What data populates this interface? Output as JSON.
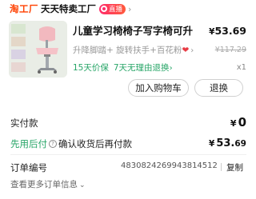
{
  "store": {
    "logo_text": "淘工厂",
    "name": "天天特卖工厂",
    "live_label": "直播"
  },
  "product": {
    "title": "儿童学习椅椅子写字椅可升",
    "price_currency": "¥",
    "price_value": "53.69",
    "spec_text": "升降脚踏+ 旋转扶手+百花粉",
    "original_price": "¥117.29",
    "promise_1": "15天价保",
    "promise_2": "7天无理由退换",
    "quantity": "x1"
  },
  "buttons": {
    "add_to_cart": "加入购物车",
    "return": "退换"
  },
  "payment": {
    "paid_label": "实付款",
    "paid_currency": "¥",
    "paid_value": "0",
    "credit_brand": "先用后付",
    "credit_rest": "确认收货后再付款",
    "credit_currency": "¥",
    "credit_int": "53.",
    "credit_cents": "69"
  },
  "order": {
    "number_label": "订单编号",
    "number_value": "4830824269943814512",
    "copy_label": "复制",
    "more_label": "查看更多订单信息"
  },
  "colors": {
    "accent": "#ff4000",
    "credit_green": "#27a567",
    "heart_red": "#e83b44"
  }
}
